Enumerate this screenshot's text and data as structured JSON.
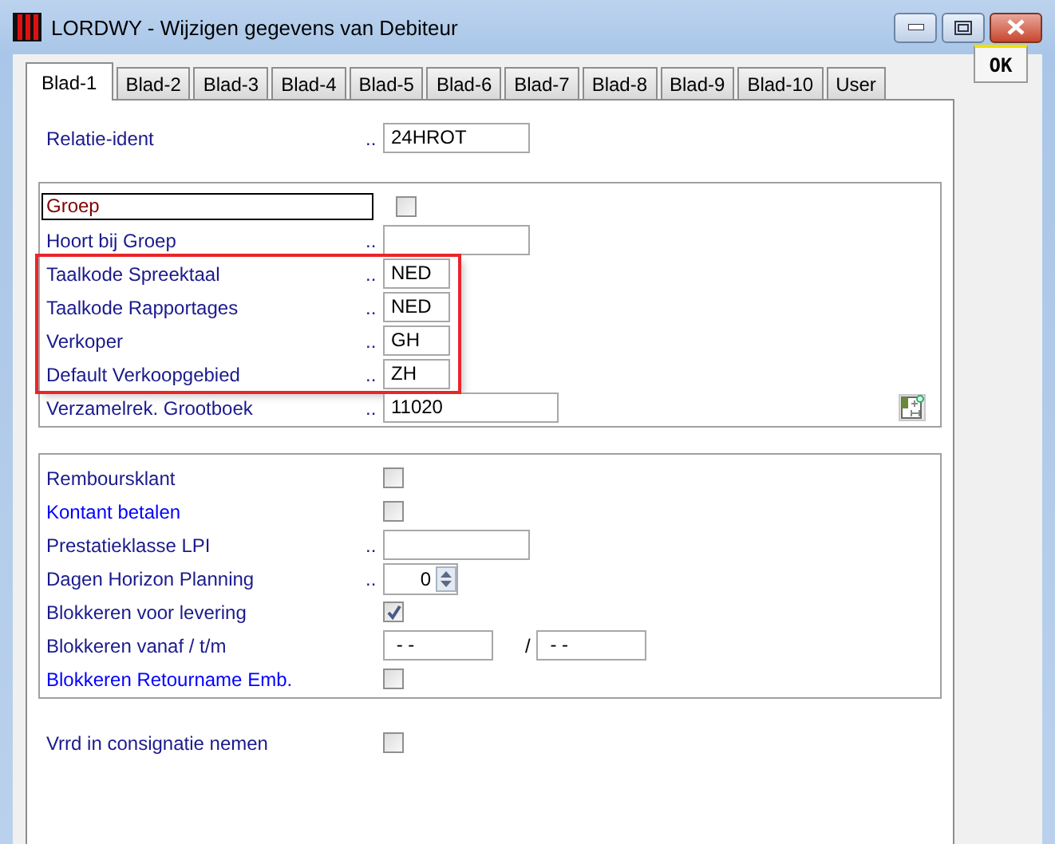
{
  "window": {
    "title": "LORDWY - Wijzigen gegevens van Debiteur"
  },
  "tabs": [
    {
      "label": "Blad-1",
      "selected": true
    },
    {
      "label": "Blad-2",
      "selected": false
    },
    {
      "label": "Blad-3",
      "selected": false
    },
    {
      "label": "Blad-4",
      "selected": false
    },
    {
      "label": "Blad-5",
      "selected": false
    },
    {
      "label": "Blad-6",
      "selected": false
    },
    {
      "label": "Blad-7",
      "selected": false
    },
    {
      "label": "Blad-8",
      "selected": false
    },
    {
      "label": "Blad-9",
      "selected": false
    },
    {
      "label": "Blad-10",
      "selected": false
    },
    {
      "label": "User",
      "selected": false
    }
  ],
  "ok_button": {
    "label": "OK"
  },
  "sections": [
    {
      "framed": false,
      "rows": [
        {
          "kind": "field",
          "label": "Relatie-ident",
          "dots": "..",
          "value": "24HROT",
          "highlighted": false
        }
      ]
    },
    {
      "framed": true,
      "rows": [
        {
          "kind": "checkbox",
          "label": "Groep",
          "focused": true,
          "checked": false,
          "highlighted": false
        },
        {
          "kind": "field",
          "label": "Hoort bij Groep",
          "dots": "..",
          "highlighted": false
        },
        {
          "kind": "code_field",
          "label": "Taalkode Spreektaal",
          "dots": "..",
          "value": "NED",
          "highlighted": true
        },
        {
          "kind": "code_field",
          "label": "Taalkode Rapportages",
          "dots": "..",
          "value": "NED",
          "highlighted": true
        },
        {
          "kind": "code_field",
          "label": "Verkoper",
          "dots": "..",
          "value": "GH",
          "highlighted": true
        },
        {
          "kind": "code_field",
          "label": "Default Verkoopgebied",
          "dots": "..",
          "value": "ZH",
          "highlighted": true
        },
        {
          "kind": "wide_field",
          "label": "Verzamelrek. Grootboek",
          "dots": "..",
          "value": "11020",
          "lookup": true,
          "highlighted": false
        }
      ]
    },
    {
      "framed": true,
      "rows": [
        {
          "kind": "checkbox",
          "label": "Remboursklant",
          "checked": false,
          "highlighted": false
        },
        {
          "kind": "checkbox",
          "label": "Kontant betalen",
          "checked": false,
          "color": "#0000ff",
          "highlighted": false
        },
        {
          "kind": "field",
          "label": "Prestatieklasse LPI",
          "dots": "..",
          "highlighted": false
        },
        {
          "kind": "spinner",
          "label": "Dagen Horizon Planning",
          "dots": "..",
          "value": "0",
          "highlighted": false
        },
        {
          "kind": "checkbox",
          "label": "Blokkeren voor levering",
          "checked": true,
          "highlighted": false
        },
        {
          "kind": "date_range",
          "label": "Blokkeren vanaf / t/m",
          "from": "- -",
          "separator": "/",
          "to": "- -",
          "highlighted": false
        },
        {
          "kind": "checkbox",
          "label": "Blokkeren Retourname Emb.",
          "checked": false,
          "color": "#0000ff",
          "highlighted": false
        }
      ]
    },
    {
      "framed": false,
      "rows": [
        {
          "kind": "checkbox",
          "label": "Vrrd in consignatie nemen",
          "checked": false,
          "highlighted": false
        }
      ]
    }
  ]
}
